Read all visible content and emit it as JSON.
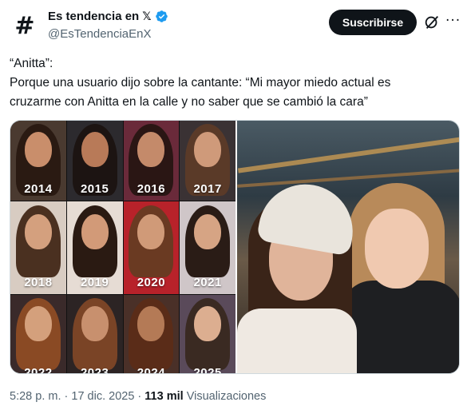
{
  "author": {
    "display_name": "Es tendencia en",
    "x_badge": "𝕏",
    "handle": "@EsTendenciaEnX",
    "avatar_glyph": "#"
  },
  "header": {
    "subscribe_label": "Suscribirse",
    "more_glyph": "···"
  },
  "tweet": {
    "lines": [
      "“Anitta”:",
      "Porque una usuario dijo sobre la cantante: “Mi mayor miedo actual es",
      "cruzarme con Anitta en la calle y no saber que se cambió la cara”"
    ]
  },
  "media": {
    "collage_years": [
      "2014",
      "2015",
      "2016",
      "2017",
      "2018",
      "2019",
      "2020",
      "2021",
      "2022",
      "2023",
      "2024",
      "2025"
    ]
  },
  "footer": {
    "time": "5:28 p. m.",
    "separator": " · ",
    "date": "17 dic. 2025",
    "views_count": "113 mil",
    "views_label": "Visualizaciones"
  },
  "colors": {
    "verified": "#1d9bf0",
    "text_primary": "#0f1419",
    "text_secondary": "#536471",
    "button_bg": "#0f1419"
  }
}
